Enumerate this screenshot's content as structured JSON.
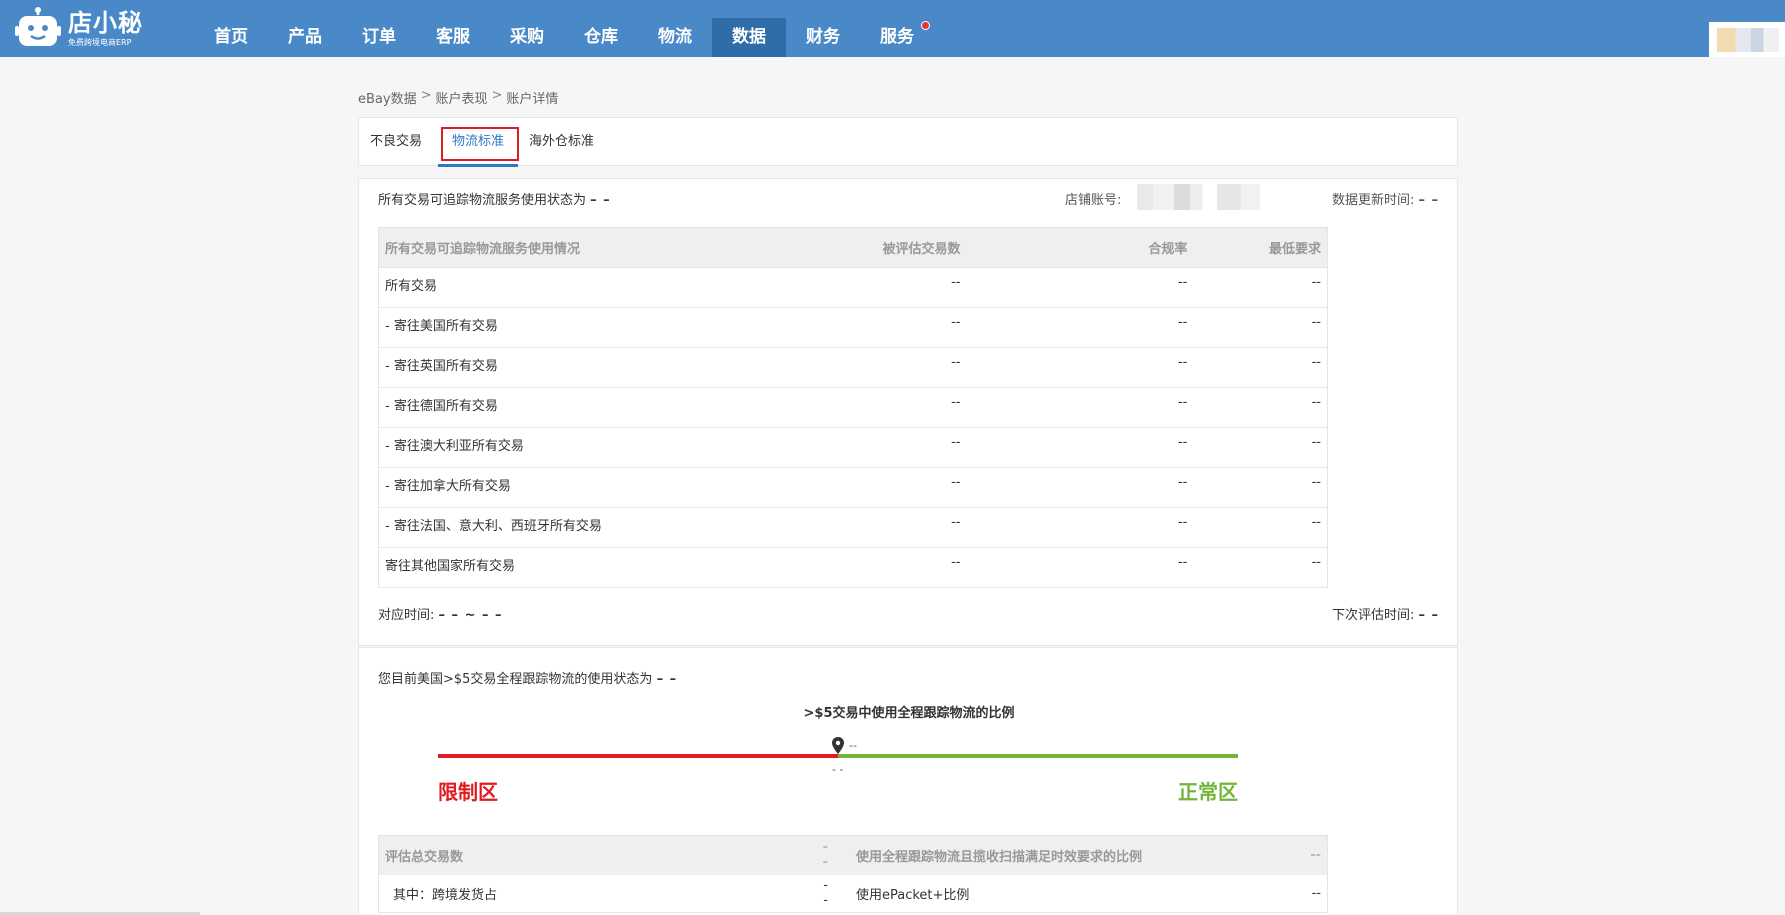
{
  "app": {
    "logo_title": "店小秘",
    "logo_subtitle": "免费跨境电商ERP"
  },
  "nav": {
    "items": [
      {
        "label": "首页"
      },
      {
        "label": "产品"
      },
      {
        "label": "订单"
      },
      {
        "label": "客服"
      },
      {
        "label": "采购"
      },
      {
        "label": "仓库"
      },
      {
        "label": "物流"
      },
      {
        "label": "数据"
      },
      {
        "label": "财务"
      },
      {
        "label": "服务"
      }
    ],
    "active": "数据"
  },
  "breadcrumb": [
    "eBay数据",
    "账户表现",
    "账户详情"
  ],
  "breadcrumb_sep": ">",
  "tabs": [
    {
      "label": "不良交易"
    },
    {
      "label": "物流标准"
    },
    {
      "label": "海外仓标准"
    }
  ],
  "section1": {
    "status_text": "所有交易可追踪物流服务使用状态为",
    "status_value": "– –",
    "store_label": "店铺账号:",
    "update_label": "数据更新时间:",
    "update_value": "– –",
    "columns": [
      "所有交易可追踪物流服务使用情况",
      "被评估交易数",
      "合规率",
      "最低要求"
    ],
    "rows": [
      {
        "name": "所有交易",
        "count": "--",
        "rate": "--",
        "min": "--"
      },
      {
        "name": "- 寄往美国所有交易",
        "count": "--",
        "rate": "--",
        "min": "--"
      },
      {
        "name": "- 寄往英国所有交易",
        "count": "--",
        "rate": "--",
        "min": "--"
      },
      {
        "name": "- 寄往德国所有交易",
        "count": "--",
        "rate": "--",
        "min": "--"
      },
      {
        "name": "- 寄往澳大利亚所有交易",
        "count": "--",
        "rate": "--",
        "min": "--"
      },
      {
        "name": "- 寄往加拿大所有交易",
        "count": "--",
        "rate": "--",
        "min": "--"
      },
      {
        "name": "- 寄往法国、意大利、西班牙所有交易",
        "count": "--",
        "rate": "--",
        "min": "--"
      },
      {
        "name": "寄往其他国家所有交易",
        "count": "--",
        "rate": "--",
        "min": "--"
      }
    ],
    "period_label": "对应时间:",
    "period_value": "– – ~ – –",
    "next_eval_label": "下次评估时间:",
    "next_eval_value": "– –"
  },
  "section2": {
    "status_text": "您目前美国>$5交易全程跟踪物流的使用状态为",
    "status_value": "– –",
    "progress_title": ">$5交易中使用全程跟踪物流的比例",
    "pin_value": "--",
    "threshold_value": "- -",
    "threshold_fraction": 0.5,
    "zone_restricted": "限制区",
    "zone_normal": "正常区",
    "colors": {
      "restricted": "#e21b23",
      "normal": "#74b539"
    },
    "table_header": {
      "left_label": "评估总交易数",
      "left_value": "--",
      "right_label": "使用全程跟踪物流且揽收扫描满足时效要求的比例",
      "right_value": "--"
    },
    "table_row": {
      "left_label": "其中：跨境发货占",
      "left_value": "--",
      "right_label": "使用ePacket+比例",
      "right_value": "--"
    }
  }
}
